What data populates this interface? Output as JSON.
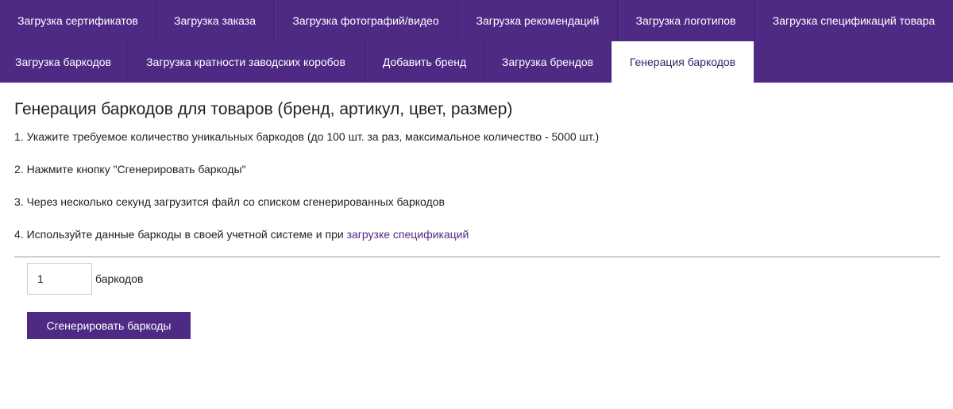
{
  "tabs": {
    "row1": [
      {
        "label": "Загрузка сертификатов"
      },
      {
        "label": "Загрузка заказа"
      },
      {
        "label": "Загрузка фотографий/видео"
      },
      {
        "label": "Загрузка рекомендаций"
      },
      {
        "label": "Загрузка логотипов"
      },
      {
        "label": "Загрузка спецификаций товара"
      }
    ],
    "row2": [
      {
        "label": "Загрузка баркодов"
      },
      {
        "label": "Загрузка кратности заводских коробов"
      },
      {
        "label": "Добавить бренд"
      },
      {
        "label": "Загрузка брендов"
      },
      {
        "label": "Генерация баркодов",
        "active": true
      }
    ]
  },
  "main": {
    "title": "Генерация баркодов для товаров (бренд, артикул, цвет, размер)",
    "steps": [
      "1. Укажите требуемое количество уникальных баркодов (до 100 шт. за раз, максимальное количество - 5000 шт.)",
      "2. Нажмите кнопку \"Сгенерировать баркоды\"",
      "3. Через несколько секунд загрузится файл со списком сгенерированных баркодов"
    ],
    "step4_prefix": "4. Используйте данные баркоды в своей учетной системе и при ",
    "step4_link": "загрузке спецификаций",
    "form": {
      "count_value": "1",
      "unit_label": "баркодов",
      "generate_label": "Сгенерировать баркоды"
    }
  },
  "colors": {
    "brand": "#4e2a84",
    "link": "#4e2a84",
    "active_tab_text": "#3a1c66"
  }
}
